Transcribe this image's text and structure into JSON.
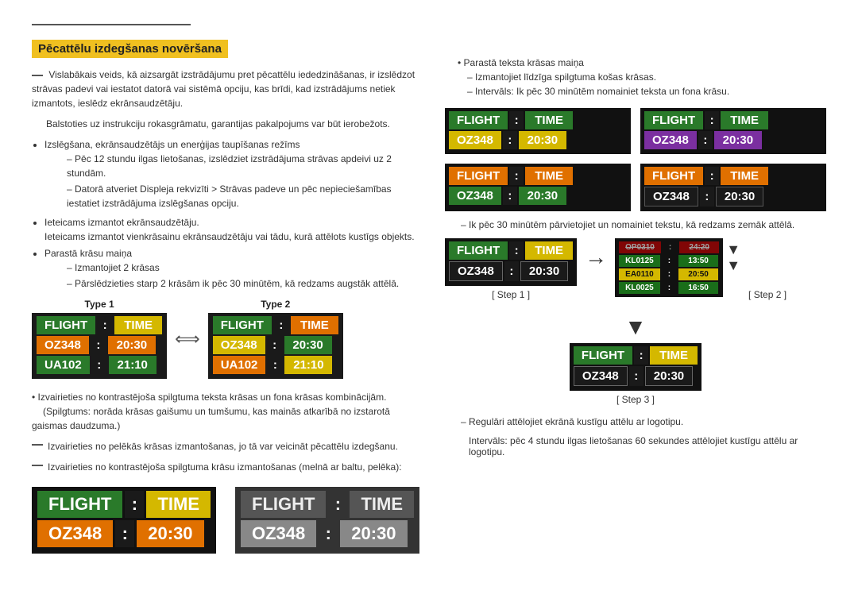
{
  "page": {
    "section_title": "Pēcattēlu izdegšanas novēršana",
    "top_rule_note1": "Vislabākais veids, kā aizsargāt izstrādājumu pret pēcattēlu iededzināšanas, ir izslēdzot strāvas padevi vai iestatot datorā vai sistēmā opciju, kas brīdi, kad izstrādājums netiek izmantots, ieslēdz ekrānsaudzētāju.",
    "top_rule_note2": "Balstoties uz instrukciju rokasgrāmatu, garantijas pakalpojums var būt ierobežots.",
    "bullet1": "Izslēgšana, ekrānsaudzētājs un enerģijas taupīšanas režīms",
    "dash1a": "Pēc 12 stundu ilgas lietošanas, izslēdziet izstrādājuma strāvas apdeivi uz 2 stundām.",
    "dash1b": "Datorā atveriet Displeja rekvizīti > Strāvas padeve un pēc nepieciešamības iestatiet izstrādājuma izslēgšanas opciju.",
    "bullet2_intro": "Ieteicams izmantot ekrānsaudzētāju.",
    "bullet2_detail": "Ieteicams izmantot vienkrāsainu ekrānsaudzētāju vai tādu, kurā attēlots kustīgs objekts.",
    "bullet3": "Parastā krāsu maiņa",
    "dash3a": "Izmantojiet 2 krāsas",
    "dash3b": "Pārslēdzieties starp 2 krāsām ik pēc 30 minūtēm, kā redzams augstāk attēlā.",
    "type1_label": "Type 1",
    "type2_label": "Type 2",
    "note_avoid1": "Izvairieties no kontrastējoša spilgtuma teksta krāsas un fona krāsas kombinācijām.",
    "note_avoid1_detail": "(Spilgtums: norāda krāsas gaišumu un tumšumu, kas mainās atkarībā no izstarotā gaismas daudzuma.)",
    "note_avoid2": "Izvairieties no pelēkās krāsas izmantošanas, jo tā var veicināt pēcattēlu izdegšanu.",
    "note_avoid3": "Izvairieties no kontrastējoša spilgtuma krāsu izmantošanas (melnā ar baltu, pelēka):",
    "right_col": {
      "sub_bullet": "Parastā teksta krāsas maiņa",
      "dash_r1": "Izmantojiet līdzīga spilgtuma košas krāsas.",
      "dash_r2": "Intervāls: Ik pēc 30 minūtēm nomainiet teksta un fona krāsu.",
      "boards_row1": [
        {
          "header": [
            "FLIGHT",
            ":",
            "TIME"
          ],
          "row1": [
            "OZ348",
            ":",
            "20:30"
          ],
          "style": "green-yellow"
        },
        {
          "header": [
            "FLIGHT",
            ":",
            "TIME"
          ],
          "row1": [
            "OZ348",
            ":",
            "20:30"
          ],
          "style": "green-purple"
        }
      ],
      "boards_row2": [
        {
          "header": [
            "FLIGHT",
            ":",
            "TIME"
          ],
          "row1": [
            "OZ348",
            ":",
            "20:30"
          ],
          "style": "orange-green"
        },
        {
          "header": [
            "FLIGHT",
            ":",
            "TIME"
          ],
          "row1": [
            "OZ348",
            ":",
            "20:30"
          ],
          "style": "orange-dark"
        }
      ],
      "scroll_note": "Ik pēc 30 minūtēm pārvietojiet un nomainiet tekstu, kā redzams zemāk attēlā.",
      "step1_label": "[ Step 1 ]",
      "step2_label": "[ Step 2 ]",
      "step3_label": "[ Step 3 ]",
      "step1_board": {
        "header": [
          "FLIGHT",
          ":",
          "TIME"
        ],
        "row1": [
          "OZ348",
          ":",
          "20:30"
        ]
      },
      "step2_scrolling": [
        {
          "cells": [
            "OP0310",
            ":",
            "24:20"
          ]
        },
        {
          "cells": [
            "KL0125",
            ":",
            "13:50"
          ]
        },
        {
          "cells": [
            "EA0110",
            ":",
            "20:50"
          ]
        },
        {
          "cells": [
            "KL0025",
            ":",
            "16:50"
          ]
        }
      ],
      "step3_board": {
        "header": [
          "FLIGHT",
          ":",
          "TIME"
        ],
        "row1": [
          "OZ348",
          ":",
          "20:30"
        ]
      },
      "final_note": "Regulāri attēlojiet ekrānā kustīgu attēlu ar logotipu.",
      "final_note2": "Intervāls: pēc 4 stundu ilgas lietošanas 60 sekundes attēlojiet kustīgu attēlu ar logotipu."
    },
    "bottom_boards": [
      {
        "bg": "black",
        "header_cells": [
          "FLIGHT",
          ":",
          "TIME"
        ],
        "header_colors": [
          "green",
          "dark",
          "yellow"
        ],
        "row1_cells": [
          "OZ348",
          ":",
          "20:30"
        ],
        "row1_colors": [
          "orange",
          "dark",
          "orange"
        ]
      },
      {
        "bg": "dark",
        "header_cells": [
          "FLIGHT",
          ":",
          "TIME"
        ],
        "header_colors": [
          "white-outline",
          "dark",
          "white-outline"
        ],
        "row1_cells": [
          "OZ348",
          ":",
          "20:30"
        ],
        "row1_colors": [
          "gray",
          "dark",
          "gray"
        ]
      }
    ]
  }
}
